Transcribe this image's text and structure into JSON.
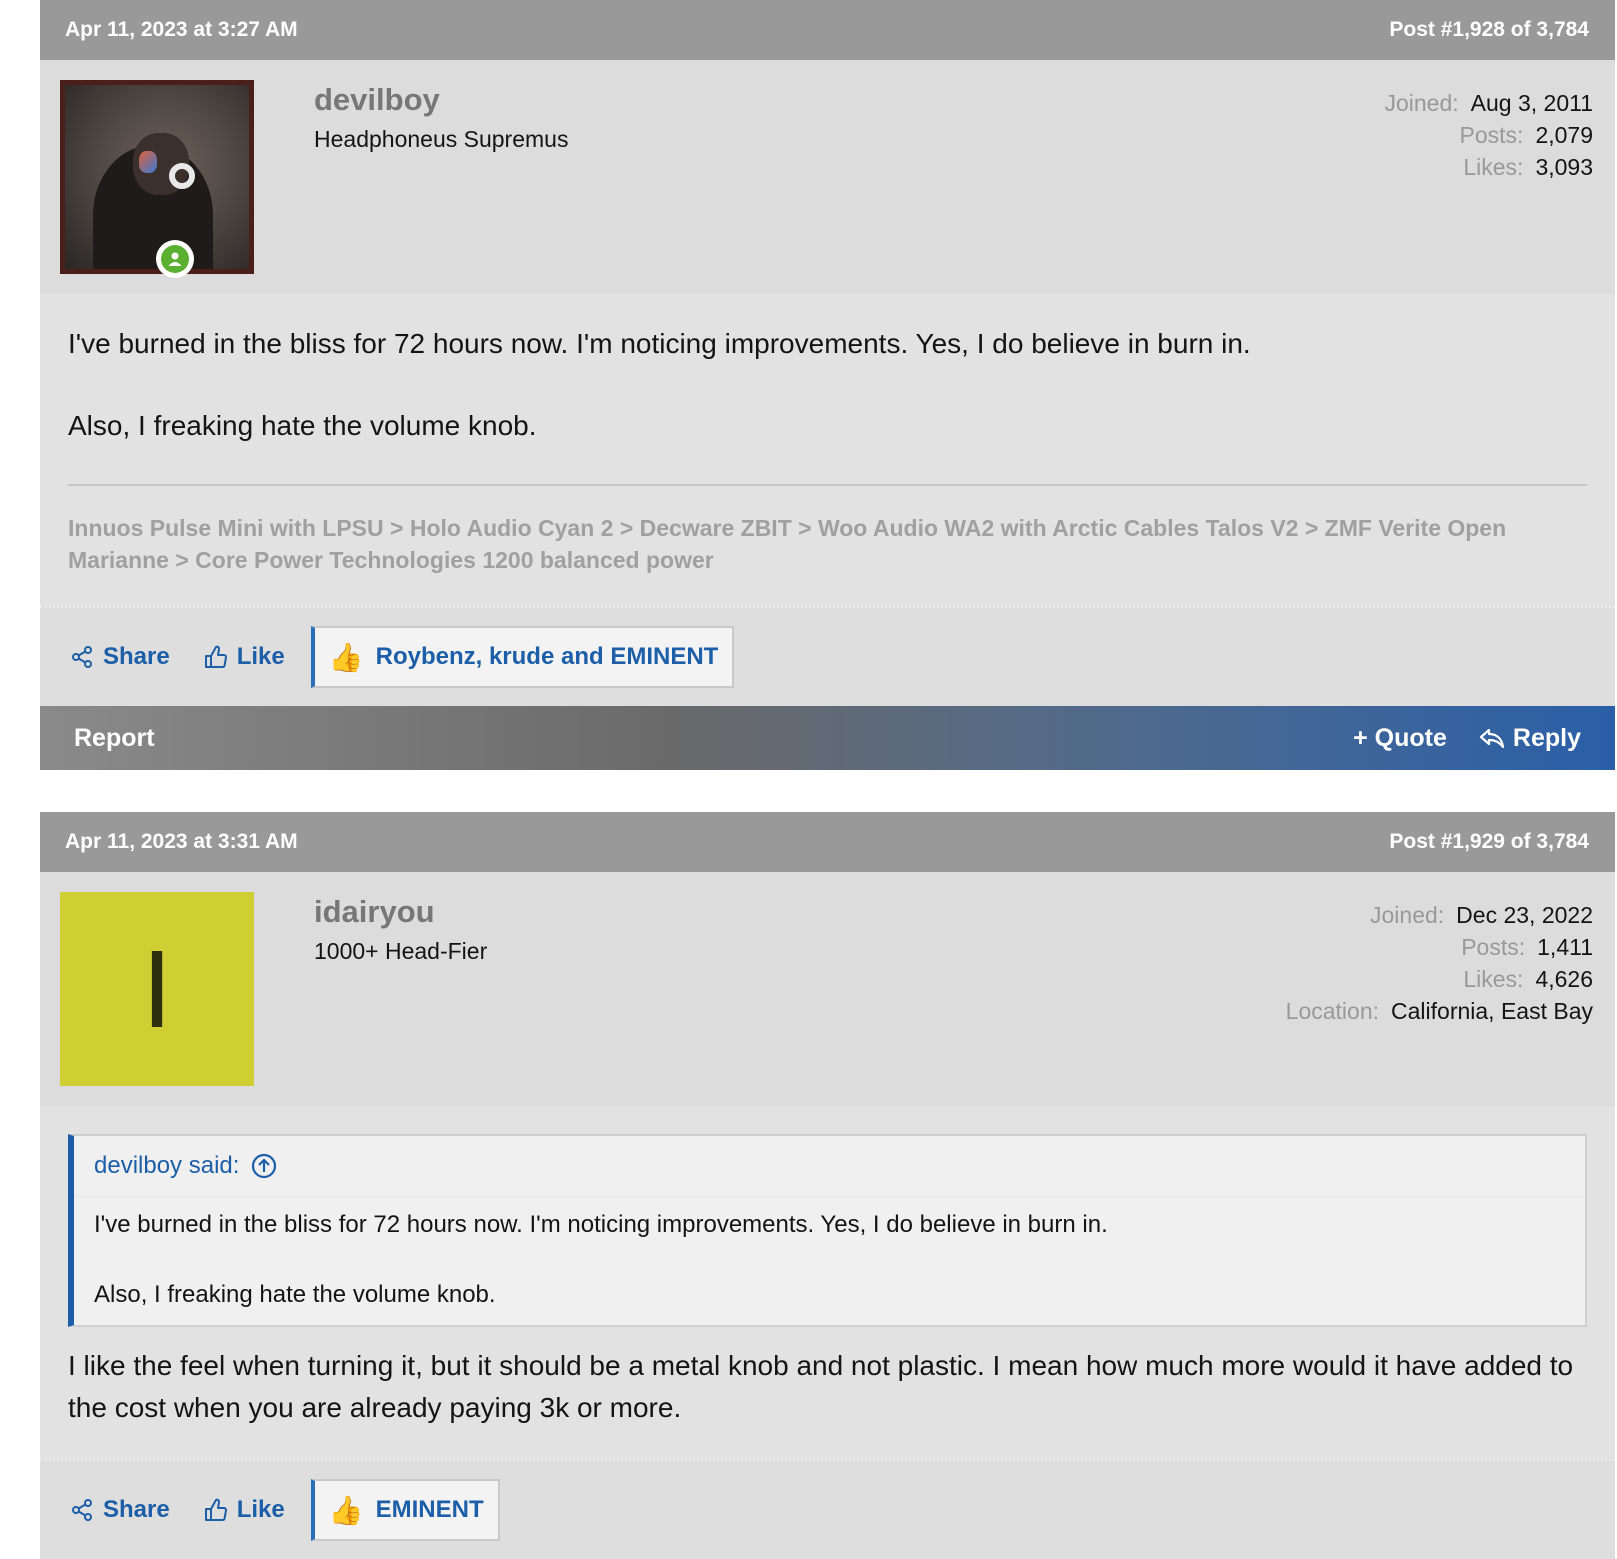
{
  "posts": [
    {
      "date": "Apr 11, 2023 at 3:27 AM",
      "post_number": "Post #1,928 of 3,784",
      "username": "devilboy",
      "user_title": "Headphoneus Supremus",
      "stats": [
        {
          "label": "Joined:",
          "value": "Aug 3, 2011"
        },
        {
          "label": "Posts:",
          "value": "2,079"
        },
        {
          "label": "Likes:",
          "value": "3,093"
        }
      ],
      "message_lines": [
        "I've burned in the bliss for 72 hours now. I'm noticing improvements. Yes, I do believe in burn in.",
        "Also, I freaking hate the volume knob."
      ],
      "signature": "Innuos Pulse Mini with LPSU > Holo Audio Cyan 2 > Decware ZBIT > Woo Audio WA2 with Arctic Cables Talos V2 > ZMF Verite Open Marianne > Core Power Technologies 1200 balanced power",
      "share_label": "Share",
      "like_label": "Like",
      "likes_list": "Roybenz, krude and EMINENT",
      "report_label": "Report",
      "quote_label": "+ Quote",
      "reply_label": "Reply"
    },
    {
      "date": "Apr 11, 2023 at 3:31 AM",
      "post_number": "Post #1,929 of 3,784",
      "username": "idairyou",
      "avatar_letter": "I",
      "user_title": "1000+ Head-Fier",
      "stats": [
        {
          "label": "Joined:",
          "value": "Dec 23, 2022"
        },
        {
          "label": "Posts:",
          "value": "1,411"
        },
        {
          "label": "Likes:",
          "value": "4,626"
        },
        {
          "label": "Location:",
          "value": "California, East Bay"
        }
      ],
      "quote": {
        "author": "devilboy said:",
        "lines": [
          "I've burned in the bliss for 72 hours now. I'm noticing improvements. Yes, I do believe in burn in.",
          "Also, I freaking hate the volume knob."
        ]
      },
      "message": "I like the feel when turning it, but it should be a metal knob and not plastic. I mean how much more would it have added to the cost when you are already paying 3k or more.",
      "share_label": "Share",
      "like_label": "Like",
      "likes_list": "EMINENT"
    }
  ],
  "colors": {
    "header_bg": "#999999",
    "link_blue": "#1c5fa8",
    "online_green": "#5cb031",
    "avatar_yellow": "#cfcf33"
  },
  "icons": [
    "share-icon",
    "like-icon",
    "thumbs-up-icon",
    "reply-icon",
    "arrow-up-circle-icon",
    "online-status-icon"
  ]
}
